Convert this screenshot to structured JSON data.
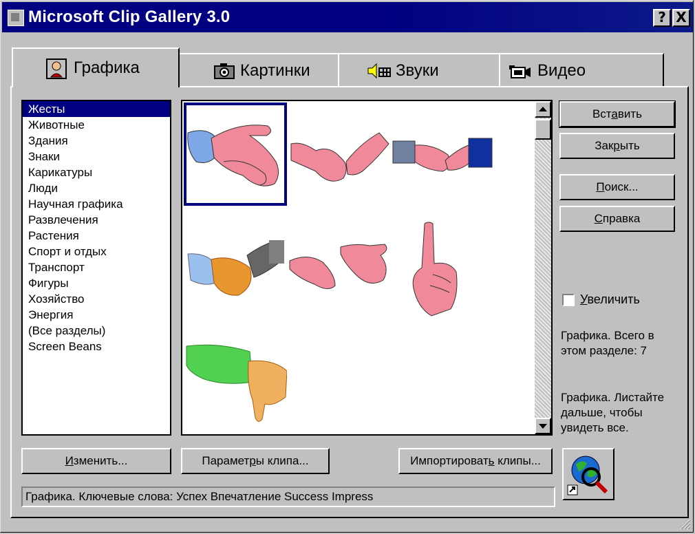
{
  "window": {
    "title": "Microsoft Clip Gallery 3.0",
    "help_label": "?",
    "close_label": "X"
  },
  "tabs": [
    {
      "label": "Графика",
      "icon": "clipart-person-icon"
    },
    {
      "label": "Картинки",
      "icon": "camera-icon"
    },
    {
      "label": "Звуки",
      "icon": "speaker-icon"
    },
    {
      "label": "Видео",
      "icon": "video-camera-icon"
    }
  ],
  "categories": {
    "items": [
      "Жесты",
      "Животные",
      "Здания",
      "Знаки",
      "Карикатуры",
      "Люди",
      "Научная графика",
      "Развлечения",
      "Растения",
      "Спорт и отдых",
      "Транспорт",
      "Фигуры",
      "Хозяйство",
      "Энергия",
      "(Все разделы)",
      "Screen Beans"
    ],
    "selected": "Жесты"
  },
  "gallery": {
    "clips": [
      "hands-together-icon",
      "handshake-icon",
      "handshake-suits-icon",
      "handshake-color-icon",
      "open-hands-icon",
      "pointing-finger-up-icon",
      "thumbs-down-icon"
    ],
    "selected_index": 0
  },
  "buttons": {
    "insert": {
      "pre": "Вст",
      "acc": "а",
      "post": "вить"
    },
    "close": {
      "pre": "Зак",
      "acc": "р",
      "post": "ыть"
    },
    "find": {
      "pre": "",
      "acc": "П",
      "post": "оиск..."
    },
    "help": {
      "pre": "",
      "acc": "С",
      "post": "правка"
    },
    "edit": {
      "pre": "",
      "acc": "И",
      "post": "зменить..."
    },
    "clip_props": {
      "pre": "Парамет",
      "acc": "р",
      "post": "ы клипа..."
    },
    "import": {
      "pre": "Импортироват",
      "acc": "ь",
      "post": " клипы..."
    }
  },
  "magnify": {
    "checked": false,
    "pre": "",
    "acc": "У",
    "post": "величить"
  },
  "info": {
    "count_text_1": "Графика. Всего в",
    "count_text_2": "этом разделе: 7",
    "scroll_text_1": "Графика. Листайте",
    "scroll_text_2": "дальше, чтобы",
    "scroll_text_3": "увидеть все."
  },
  "status": {
    "text": "Графика. Ключевые слова:  Успех Впечатление Success Impress"
  },
  "colors": {
    "title_bar": "#000080",
    "selection": "#000080",
    "face": "#c0c0c0"
  }
}
